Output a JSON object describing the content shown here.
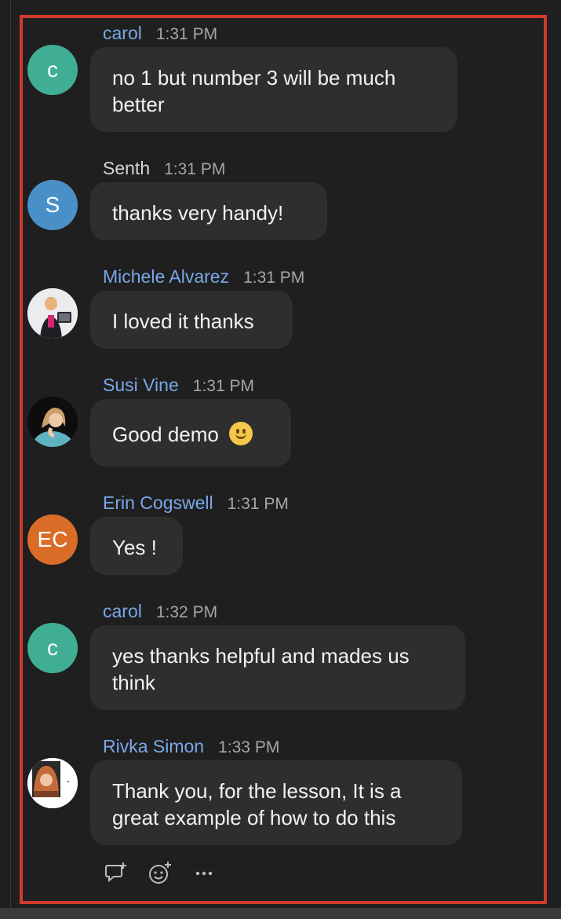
{
  "chat": {
    "messages": [
      {
        "sender": "carol",
        "time": "1:31 PM",
        "avatar_initials": "c",
        "avatar_color": "#3fae94",
        "text_lines": [
          "no 1 but number 3 will be much",
          "better"
        ]
      },
      {
        "sender": "Senth",
        "time": "1:31 PM",
        "avatar_initials": "S",
        "avatar_color": "#4a90c8",
        "text_lines": [
          "thanks very handy!"
        ]
      },
      {
        "sender": "Michele Alvarez",
        "time": "1:31 PM",
        "avatar_type": "photo",
        "text_lines": [
          "I loved it thanks"
        ]
      },
      {
        "sender": "Susi Vine",
        "time": "1:31 PM",
        "avatar_type": "photo",
        "text_lines": [
          "Good demo"
        ],
        "emoji": "slightly-smiling-face"
      },
      {
        "sender": "Erin Cogswell",
        "time": "1:31 PM",
        "avatar_initials": "EC",
        "avatar_color": "#d96d28",
        "text_lines": [
          "Yes !"
        ]
      },
      {
        "sender": "carol",
        "time": "1:32 PM",
        "avatar_initials": "c",
        "avatar_color": "#3fae94",
        "text_lines": [
          "yes thanks helpful and mades us",
          "think"
        ]
      },
      {
        "sender": "Rivka Simon",
        "time": "1:33 PM",
        "avatar_type": "photo",
        "text_lines": [
          "Thank you, for the lesson, It is a",
          "great example of how to do this"
        ]
      }
    ],
    "actions": {
      "reply_icon": "reply-in-thread-icon",
      "react_icon": "add-reaction-icon",
      "more_icon": "more-options-icon"
    }
  },
  "colors": {
    "highlight": "#cf3a2a",
    "sender_link": "#7aa7e8",
    "bubble_bg": "#2e2e2e",
    "page_bg": "#1f1f1f"
  }
}
